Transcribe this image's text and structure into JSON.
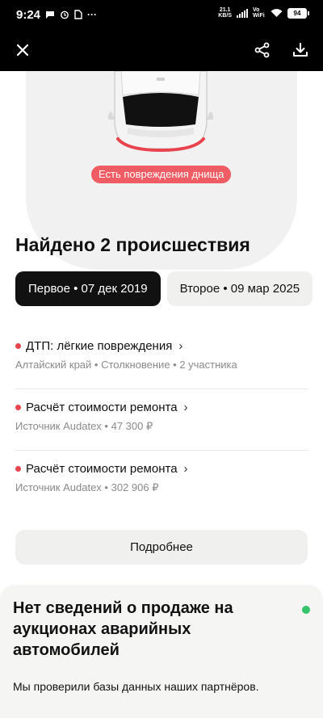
{
  "status_bar": {
    "time": "9:24",
    "net_speed_value": "21.1",
    "net_speed_unit": "KB/S",
    "vowifi": "Vo WiFi",
    "battery": "94"
  },
  "app_bar": {
    "close_icon": "close-icon",
    "share_icon": "share-icon",
    "download_icon": "download-icon"
  },
  "hero": {
    "badge": "Есть повреждения днища"
  },
  "incidents_section": {
    "title": "Найдено 2 происшествия",
    "tabs": [
      {
        "label": "Первое",
        "date": "07 дек 2019",
        "active": true
      },
      {
        "label": "Второе",
        "date": "09 мар 2025",
        "active": false
      }
    ],
    "items": [
      {
        "title": "ДТП: лёгкие повреждения",
        "subtitle": "Алтайский край • Столкновение • 2 участника"
      },
      {
        "title": "Расчёт стоимости ремонта",
        "subtitle": "Источник Audatex • 47 300 ₽"
      },
      {
        "title": "Расчёт стоимости ремонта",
        "subtitle": "Источник Audatex • 302 906 ₽"
      }
    ],
    "more_button": "Подробнее"
  },
  "auction_card": {
    "title": "Нет сведений о продаже на аукционах аварийных автомобилей",
    "text": "Мы проверили базы данных наших партнёров.",
    "status_color": "#35c46b"
  },
  "colors": {
    "accent_red": "#e9434e",
    "badge_red": "#ef5c63"
  }
}
